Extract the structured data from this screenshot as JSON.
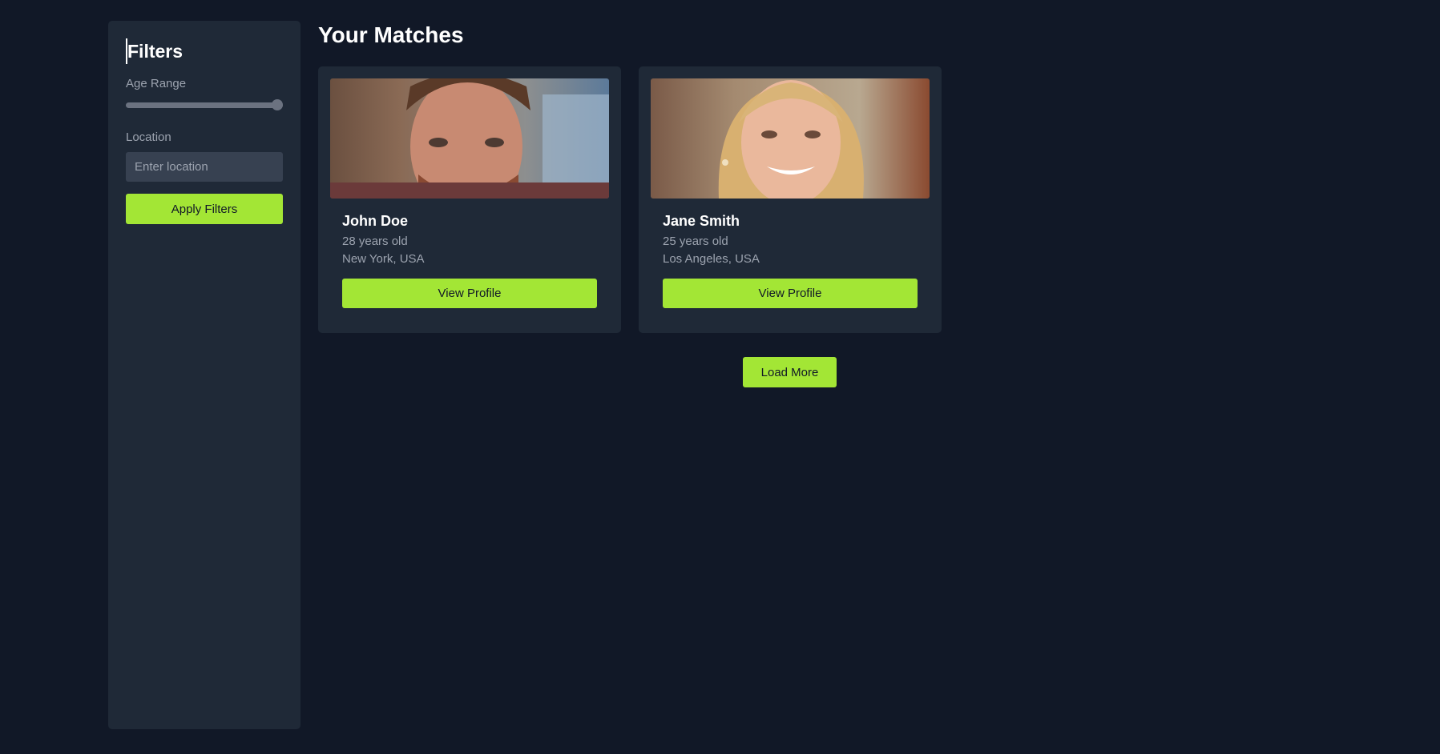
{
  "sidebar": {
    "title": "Filters",
    "age_range": {
      "label": "Age Range",
      "value_fraction": 1.0
    },
    "location": {
      "label": "Location",
      "placeholder": "Enter location",
      "value": ""
    },
    "apply_label": "Apply Filters"
  },
  "main": {
    "title": "Your Matches",
    "matches": [
      {
        "name": "John Doe",
        "age": "28 years old",
        "location": "New York, USA",
        "button_label": "View Profile"
      },
      {
        "name": "Jane Smith",
        "age": "25 years old",
        "location": "Los Angeles, USA",
        "button_label": "View Profile"
      }
    ],
    "load_more_label": "Load More"
  },
  "colors": {
    "background": "#111827",
    "panel": "#1f2937",
    "accent": "#a3e635",
    "muted_text": "#9ca3af"
  }
}
